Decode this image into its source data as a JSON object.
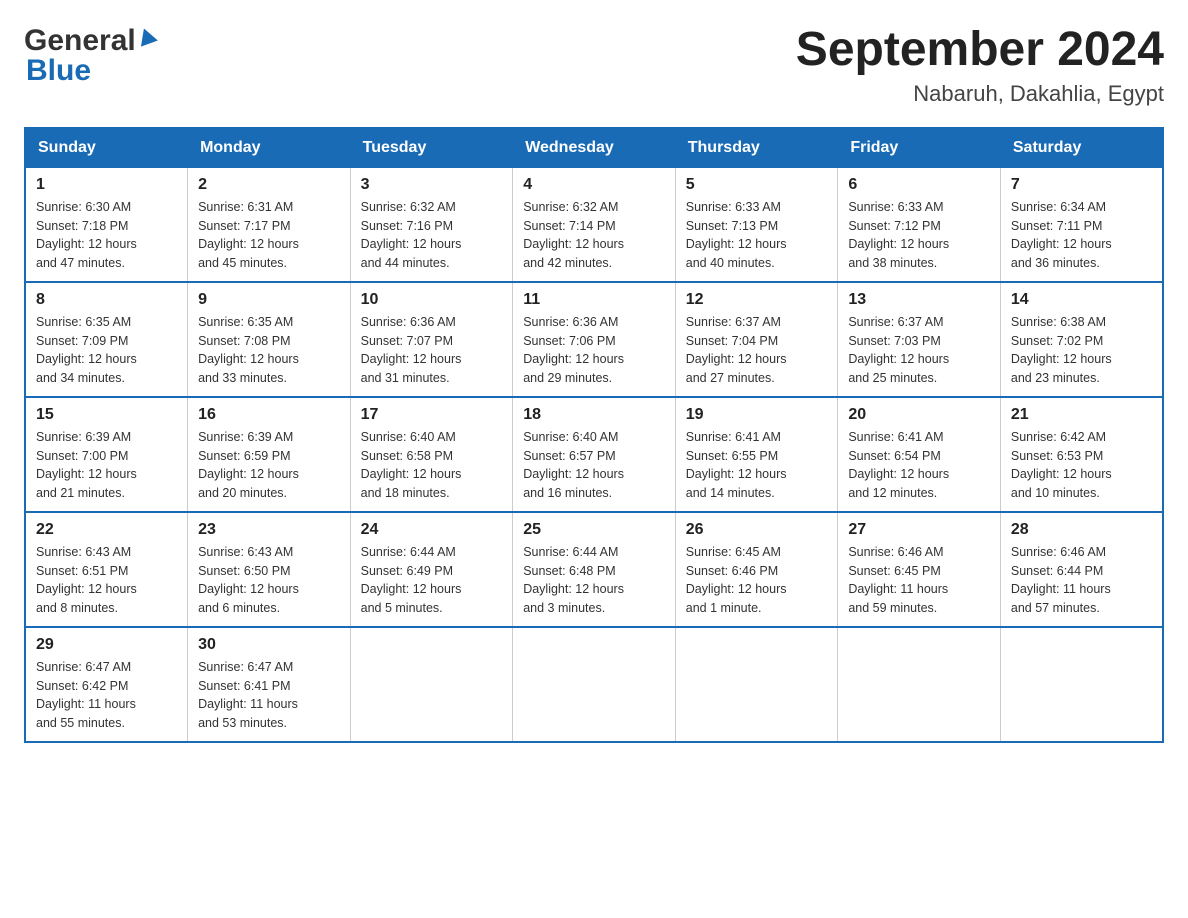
{
  "header": {
    "logo_general": "General",
    "logo_blue": "Blue",
    "month_title": "September 2024",
    "location": "Nabaruh, Dakahlia, Egypt"
  },
  "weekdays": [
    "Sunday",
    "Monday",
    "Tuesday",
    "Wednesday",
    "Thursday",
    "Friday",
    "Saturday"
  ],
  "weeks": [
    [
      {
        "day": "1",
        "sunrise": "6:30 AM",
        "sunset": "7:18 PM",
        "daylight": "12 hours and 47 minutes."
      },
      {
        "day": "2",
        "sunrise": "6:31 AM",
        "sunset": "7:17 PM",
        "daylight": "12 hours and 45 minutes."
      },
      {
        "day": "3",
        "sunrise": "6:32 AM",
        "sunset": "7:16 PM",
        "daylight": "12 hours and 44 minutes."
      },
      {
        "day": "4",
        "sunrise": "6:32 AM",
        "sunset": "7:14 PM",
        "daylight": "12 hours and 42 minutes."
      },
      {
        "day": "5",
        "sunrise": "6:33 AM",
        "sunset": "7:13 PM",
        "daylight": "12 hours and 40 minutes."
      },
      {
        "day": "6",
        "sunrise": "6:33 AM",
        "sunset": "7:12 PM",
        "daylight": "12 hours and 38 minutes."
      },
      {
        "day": "7",
        "sunrise": "6:34 AM",
        "sunset": "7:11 PM",
        "daylight": "12 hours and 36 minutes."
      }
    ],
    [
      {
        "day": "8",
        "sunrise": "6:35 AM",
        "sunset": "7:09 PM",
        "daylight": "12 hours and 34 minutes."
      },
      {
        "day": "9",
        "sunrise": "6:35 AM",
        "sunset": "7:08 PM",
        "daylight": "12 hours and 33 minutes."
      },
      {
        "day": "10",
        "sunrise": "6:36 AM",
        "sunset": "7:07 PM",
        "daylight": "12 hours and 31 minutes."
      },
      {
        "day": "11",
        "sunrise": "6:36 AM",
        "sunset": "7:06 PM",
        "daylight": "12 hours and 29 minutes."
      },
      {
        "day": "12",
        "sunrise": "6:37 AM",
        "sunset": "7:04 PM",
        "daylight": "12 hours and 27 minutes."
      },
      {
        "day": "13",
        "sunrise": "6:37 AM",
        "sunset": "7:03 PM",
        "daylight": "12 hours and 25 minutes."
      },
      {
        "day": "14",
        "sunrise": "6:38 AM",
        "sunset": "7:02 PM",
        "daylight": "12 hours and 23 minutes."
      }
    ],
    [
      {
        "day": "15",
        "sunrise": "6:39 AM",
        "sunset": "7:00 PM",
        "daylight": "12 hours and 21 minutes."
      },
      {
        "day": "16",
        "sunrise": "6:39 AM",
        "sunset": "6:59 PM",
        "daylight": "12 hours and 20 minutes."
      },
      {
        "day": "17",
        "sunrise": "6:40 AM",
        "sunset": "6:58 PM",
        "daylight": "12 hours and 18 minutes."
      },
      {
        "day": "18",
        "sunrise": "6:40 AM",
        "sunset": "6:57 PM",
        "daylight": "12 hours and 16 minutes."
      },
      {
        "day": "19",
        "sunrise": "6:41 AM",
        "sunset": "6:55 PM",
        "daylight": "12 hours and 14 minutes."
      },
      {
        "day": "20",
        "sunrise": "6:41 AM",
        "sunset": "6:54 PM",
        "daylight": "12 hours and 12 minutes."
      },
      {
        "day": "21",
        "sunrise": "6:42 AM",
        "sunset": "6:53 PM",
        "daylight": "12 hours and 10 minutes."
      }
    ],
    [
      {
        "day": "22",
        "sunrise": "6:43 AM",
        "sunset": "6:51 PM",
        "daylight": "12 hours and 8 minutes."
      },
      {
        "day": "23",
        "sunrise": "6:43 AM",
        "sunset": "6:50 PM",
        "daylight": "12 hours and 6 minutes."
      },
      {
        "day": "24",
        "sunrise": "6:44 AM",
        "sunset": "6:49 PM",
        "daylight": "12 hours and 5 minutes."
      },
      {
        "day": "25",
        "sunrise": "6:44 AM",
        "sunset": "6:48 PM",
        "daylight": "12 hours and 3 minutes."
      },
      {
        "day": "26",
        "sunrise": "6:45 AM",
        "sunset": "6:46 PM",
        "daylight": "12 hours and 1 minute."
      },
      {
        "day": "27",
        "sunrise": "6:46 AM",
        "sunset": "6:45 PM",
        "daylight": "11 hours and 59 minutes."
      },
      {
        "day": "28",
        "sunrise": "6:46 AM",
        "sunset": "6:44 PM",
        "daylight": "11 hours and 57 minutes."
      }
    ],
    [
      {
        "day": "29",
        "sunrise": "6:47 AM",
        "sunset": "6:42 PM",
        "daylight": "11 hours and 55 minutes."
      },
      {
        "day": "30",
        "sunrise": "6:47 AM",
        "sunset": "6:41 PM",
        "daylight": "11 hours and 53 minutes."
      },
      null,
      null,
      null,
      null,
      null
    ]
  ],
  "labels": {
    "sunrise": "Sunrise:",
    "sunset": "Sunset:",
    "daylight": "Daylight:"
  }
}
